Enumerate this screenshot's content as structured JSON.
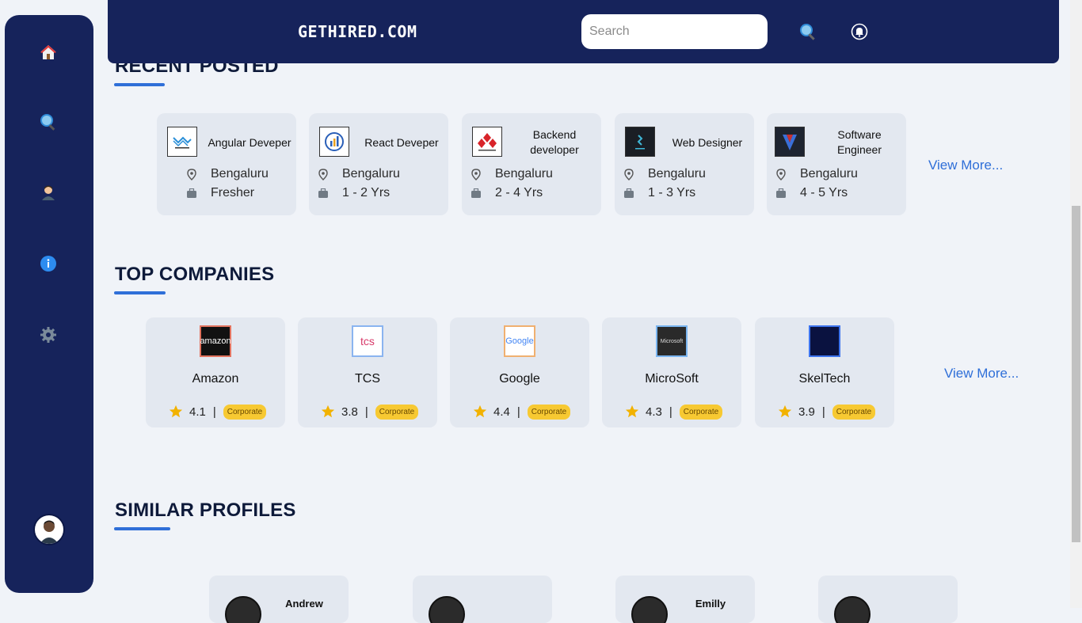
{
  "header": {
    "brand": "GETHIRED.COM",
    "search_placeholder": "Search"
  },
  "sidebar": {
    "items": [
      {
        "icon": "home-icon"
      },
      {
        "icon": "search-icon"
      },
      {
        "icon": "user-icon"
      },
      {
        "icon": "info-icon"
      },
      {
        "icon": "gear-icon"
      }
    ]
  },
  "recent": {
    "title": "RECENT POSTED",
    "view_more": "View More...",
    "jobs": [
      {
        "title": "Angular Deveper",
        "location": "Bengaluru",
        "experience": "Fresher"
      },
      {
        "title": "React Deveper",
        "location": "Bengaluru",
        "experience": "1 - 2 Yrs"
      },
      {
        "title": "Backend developer",
        "location": "Bengaluru",
        "experience": "2 - 4 Yrs"
      },
      {
        "title": "Web Designer",
        "location": "Bengaluru",
        "experience": "1 - 3 Yrs"
      },
      {
        "title": "Software Engineer",
        "location": "Bengaluru",
        "experience": "4 - 5 Yrs"
      }
    ]
  },
  "companies": {
    "title": "TOP COMPANIES",
    "view_more": "View More...",
    "items": [
      {
        "name": "Amazon",
        "rating": "4.1",
        "type": "Corporate",
        "logo_text": "amazon",
        "logo_color": "#e2735f"
      },
      {
        "name": "TCS",
        "rating": "3.8",
        "type": "Corporate",
        "logo_text": "tcs",
        "logo_color": "#8ab4f0"
      },
      {
        "name": "Google",
        "rating": "4.4",
        "type": "Corporate",
        "logo_text": "Google",
        "logo_color": "#f0b070"
      },
      {
        "name": "MicroSoft",
        "rating": "4.3",
        "type": "Corporate",
        "logo_text": "Microsoft",
        "logo_color": "#7ab5f0"
      },
      {
        "name": "SkelTech",
        "rating": "3.9",
        "type": "Corporate",
        "logo_text": "",
        "logo_color": "#3d74ee"
      }
    ]
  },
  "profiles": {
    "title": "SIMILAR PROFILES",
    "items": [
      {
        "name": "Andrew"
      },
      {
        "name": ""
      },
      {
        "name": "Emilly"
      },
      {
        "name": ""
      }
    ]
  },
  "colors": {
    "navy": "#16235b",
    "accent": "#2f6fd8",
    "badge": "#f7c932",
    "star": "#f2b200"
  }
}
